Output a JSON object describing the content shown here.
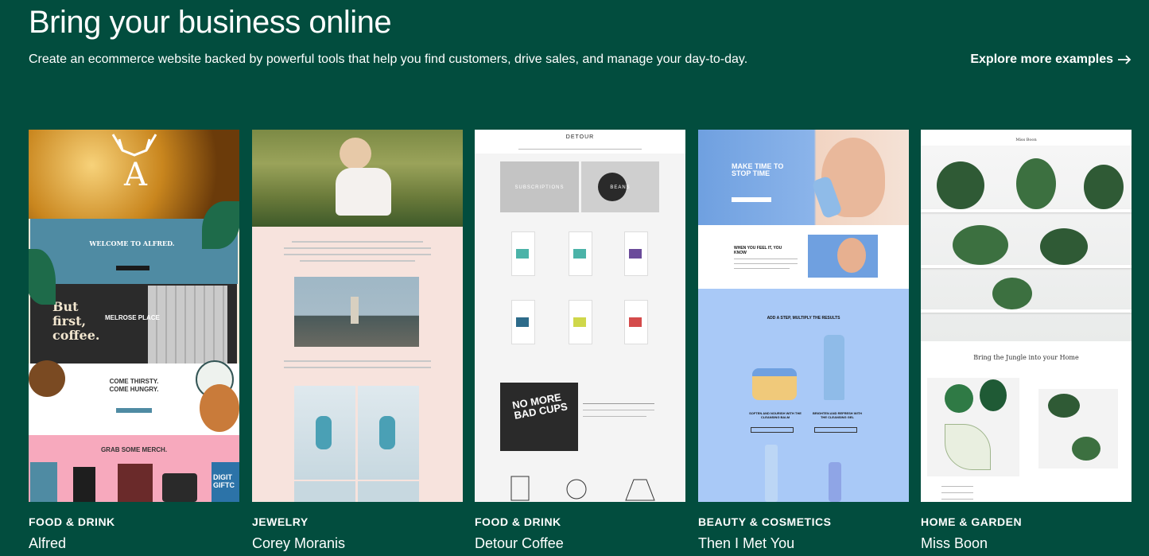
{
  "header": {
    "title": "Bring your business online",
    "subtitle": "Create an ecommerce website backed by powerful tools that help you find customers, drive sales, and manage your day-to-day.",
    "explore_label": "Explore more examples",
    "arrow_icon": "arrow-right-icon"
  },
  "cards": [
    {
      "category": "FOOD & DRINK",
      "name": "Alfred",
      "preview": {
        "welcome": "WELCOME TO ALFRED.",
        "wall_text_1": "But",
        "wall_text_2": "first,",
        "wall_text_3": "coffee.",
        "place": "MELROSE PLACE",
        "headline": "COME THIRSTY. COME HUNGRY.",
        "merch": "GRAB SOME MERCH.",
        "side": "DIGIT GIFTC"
      }
    },
    {
      "category": "JEWELRY",
      "name": "Corey Moranis"
    },
    {
      "category": "FOOD & DRINK",
      "name": "Detour Coffee",
      "preview": {
        "logo": "DETOUR",
        "tile1": "SUBSCRIPTIONS",
        "tile2": "BEANS",
        "promo": "NO MORE BAD CUPS"
      }
    },
    {
      "category": "BEAUTY & COSMETICS",
      "name": "Then I Met You",
      "preview": {
        "hero": "MAKE TIME TO STOP TIME",
        "feel": "WHEN YOU FEEL IT, YOU KNOW",
        "step": "ADD A STEP, MULTIPLY THE RESULTS",
        "left": "SOFTEN AND NOURISH WITH THE CLEANSING BALM",
        "right": "BRIGHTEN AND REFRESH WITH THE CLEANSING GEL"
      }
    },
    {
      "category": "HOME & GARDEN",
      "name": "Miss Boon",
      "preview": {
        "logo": "Miss Boon",
        "headline": "Bring the Jungle into your Home"
      }
    }
  ],
  "colors": {
    "background": "#024d3e",
    "text": "#ffffff"
  }
}
